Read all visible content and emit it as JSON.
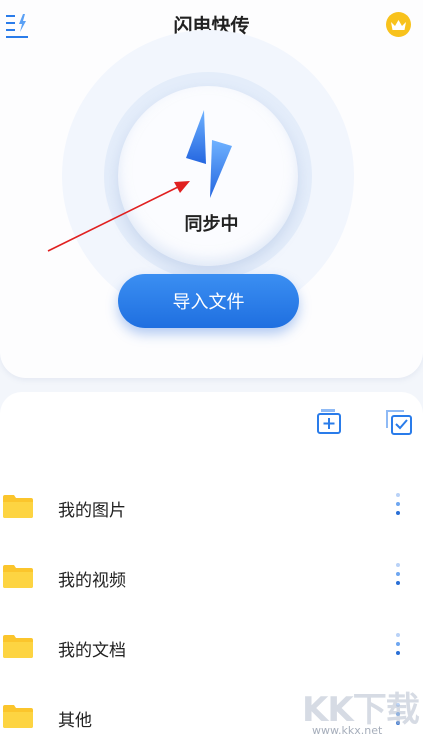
{
  "header": {
    "title": "闪电快传"
  },
  "hero": {
    "status_text": "同步中",
    "import_button_label": "导入文件"
  },
  "folders": [
    {
      "label": "我的图片"
    },
    {
      "label": "我的视频"
    },
    {
      "label": "我的文档"
    },
    {
      "label": "其他"
    }
  ],
  "icons": {
    "menu": "menu-icon",
    "vip": "crown-icon",
    "center": "lightning-bolt-icon",
    "new_folder": "new-folder-icon",
    "select": "multi-select-icon",
    "folder": "folder-icon",
    "more": "more-vertical-icon"
  },
  "watermark": {
    "brand": "KK下载",
    "url": "www.kkx.net"
  },
  "colors": {
    "accent": "#2a7cea",
    "vip_gold": "#f8c21c",
    "folder_yellow": "#fbc52c",
    "annotation_red": "#e02020"
  }
}
